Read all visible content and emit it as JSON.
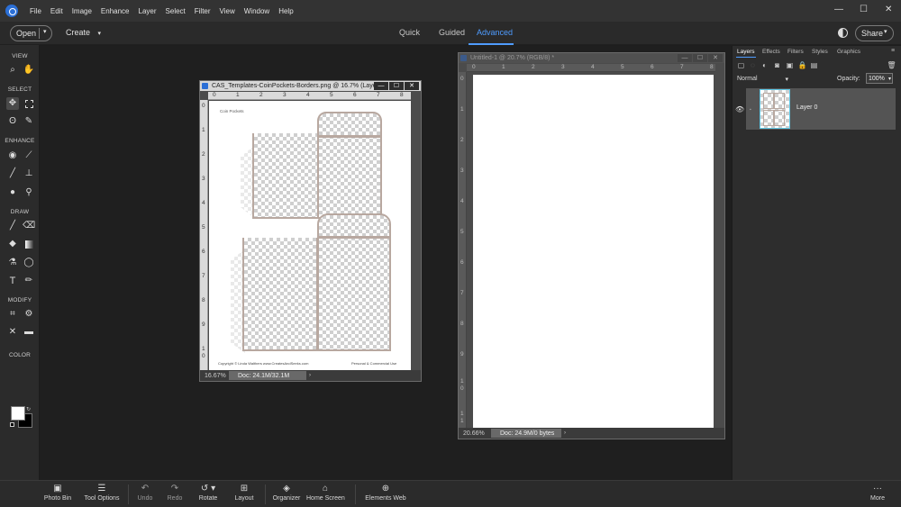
{
  "menu": [
    "File",
    "Edit",
    "Image",
    "Enhance",
    "Layer",
    "Select",
    "Filter",
    "View",
    "Window",
    "Help"
  ],
  "window_controls": {
    "minimize": "—",
    "maximize": "☐",
    "close": "✕"
  },
  "modebar": {
    "open_label": "Open",
    "create_label": "Create",
    "tabs": [
      "Quick",
      "Guided",
      "Advanced"
    ],
    "active_tab": "Advanced",
    "share_label": "Share"
  },
  "toolbox": {
    "sections": [
      "VIEW",
      "SELECT",
      "ENHANCE",
      "DRAW",
      "MODIFY",
      "COLOR"
    ],
    "foreground_color": "#ffffff",
    "background_color": "#000000"
  },
  "doc1": {
    "title": "CAS_Templates-CoinPockets-Borders.png @ 16.7% (Laye...",
    "ruler_top": [
      "0",
      "1",
      "2",
      "3",
      "4",
      "5",
      "6",
      "7",
      "8"
    ],
    "ruler_left": [
      "0",
      "1",
      "2",
      "3",
      "4",
      "5",
      "6",
      "7",
      "8",
      "9",
      "1",
      "0"
    ],
    "header_label": "Coin Pockets",
    "copyright": "Copyright © Linda Walthers www.CreatesAndSeeks.com",
    "personal": "Personal & Commercial Use",
    "zoom": "16.67%",
    "doc_info": "Doc: 24.1M/32.1M"
  },
  "doc2": {
    "title": "Untitled-1 @ 20.7% (RGB/8) *",
    "ruler_top": [
      "0",
      "1",
      "2",
      "3",
      "4",
      "5",
      "6",
      "7",
      "8"
    ],
    "ruler_left": [
      "0",
      "1",
      "2",
      "3",
      "4",
      "5",
      "6",
      "7",
      "8",
      "9",
      "1",
      "0",
      "1",
      "1"
    ],
    "zoom": "20.66%",
    "doc_info": "Doc: 24.9M/0 bytes"
  },
  "panel": {
    "tabs": [
      "Layers",
      "Effects",
      "Filters",
      "Styles",
      "Graphics"
    ],
    "active_tab": "Layers",
    "blend_mode": "Normal",
    "opacity_label": "Opacity:",
    "opacity_value": "100%",
    "layer_name": "Layer 0"
  },
  "bottombar": {
    "items": [
      "Photo Bin",
      "Tool Options",
      "Undo",
      "Redo",
      "Rotate",
      "Layout",
      "Organizer",
      "Home Screen",
      "Elements Web",
      "More"
    ]
  },
  "accent_color": "#4f9cff"
}
